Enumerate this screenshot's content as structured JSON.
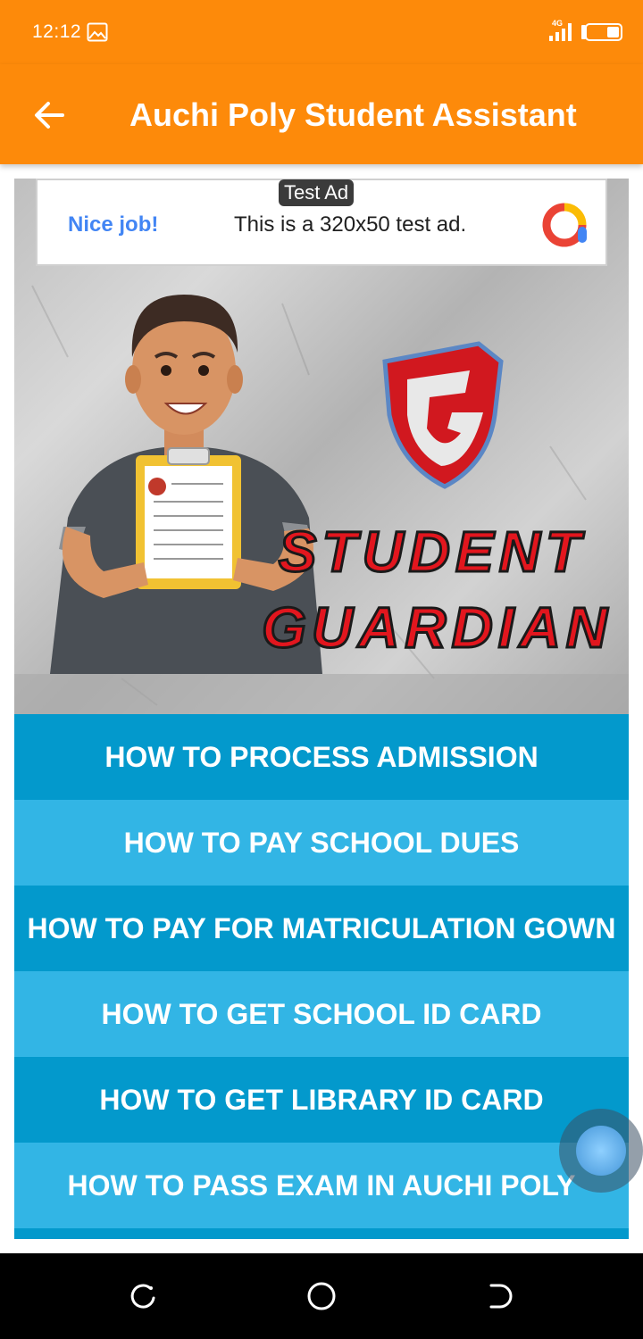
{
  "status_bar": {
    "time": "12:12",
    "network": "4G",
    "icons": [
      "gallery-icon",
      "signal-icon",
      "battery-icon"
    ]
  },
  "app_bar": {
    "title": "Auchi Poly Student Assistant",
    "back_icon": "arrow-left-icon",
    "color": "#fd8a0a"
  },
  "ad": {
    "tag": "Test Ad",
    "headline": "Nice job!",
    "text": "This is a 320x50 test ad.",
    "logo_icon": "ad-logo-icon"
  },
  "banner": {
    "line1": "STUDENT",
    "line2": "GUARDIAN",
    "logo_letter": "G"
  },
  "menu": {
    "items": [
      {
        "label": "HOW TO PROCESS ADMISSION"
      },
      {
        "label": "HOW TO PAY SCHOOL DUES"
      },
      {
        "label": "HOW TO PAY FOR MATRICULATION GOWN"
      },
      {
        "label": "HOW TO GET SCHOOL ID CARD"
      },
      {
        "label": "HOW TO GET LIBRARY ID CARD"
      },
      {
        "label": "HOW TO PASS EXAM IN AUCHI POLY"
      }
    ],
    "colors": {
      "dark": "#0399cc",
      "light": "#32b5e5"
    }
  },
  "nav_bar": {
    "icons": [
      "recent-apps-icon",
      "home-icon",
      "back-icon"
    ]
  }
}
